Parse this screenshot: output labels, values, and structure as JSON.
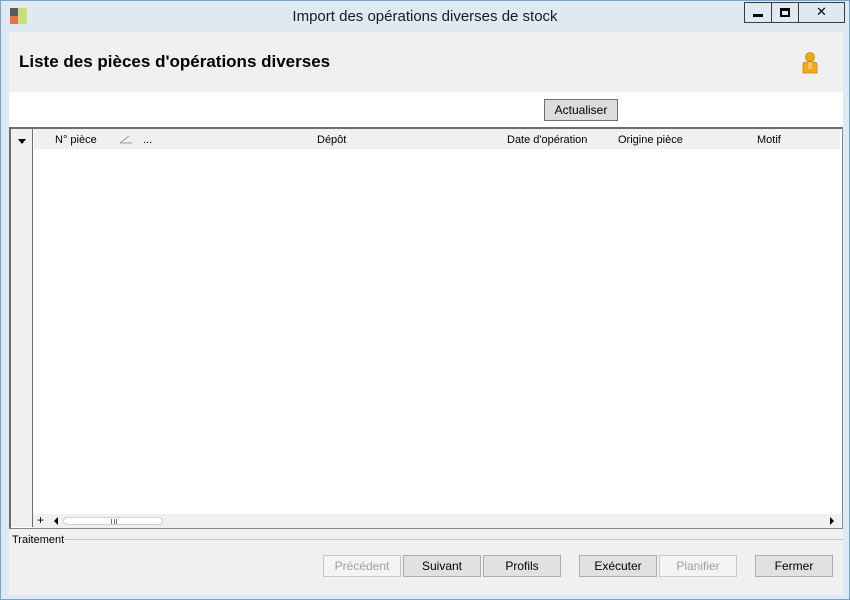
{
  "window": {
    "title": "Import des opérations diverses de stock",
    "controls": {
      "minimize": "minimize-icon",
      "maximize": "maximize-icon",
      "close": "✕"
    }
  },
  "header": {
    "title": "Liste des pièces d'opérations diverses",
    "user_icon": "user-icon"
  },
  "toolbar": {
    "refresh_label": "Actualiser"
  },
  "grid": {
    "columns": [
      "N° pièce",
      "...",
      "Dépôt",
      "Date d'opération",
      "Origine pièce",
      "Motif"
    ],
    "rows": [],
    "add_label": "+"
  },
  "footer": {
    "group_label": "Traitement",
    "buttons": {
      "previous": "Précédent",
      "next": "Suivant",
      "profiles": "Profils",
      "execute": "Exécuter",
      "plan": "Planifier",
      "close": "Fermer"
    }
  },
  "colors": {
    "frame": "#dfe9f2",
    "border": "#7aa3cc",
    "panel": "#f0f0f0",
    "disabled_text": "#a0a0a0",
    "user_icon": "#f2a81d"
  }
}
